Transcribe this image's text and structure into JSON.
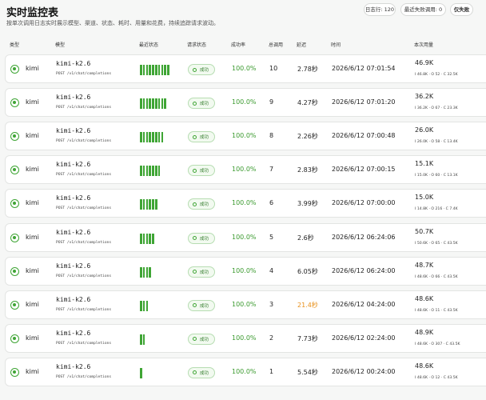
{
  "header": {
    "title": "实时监控表",
    "subtitle": "按单次调用日志实时展示模型、渠道、状态、耗时、用量和花费，持续追踪请求波动。",
    "stat_rows": "日志行: 120",
    "stat_failed": "最近失败调用: 0",
    "filter_button": "仅失败"
  },
  "table": {
    "columns": [
      "类型",
      "模型",
      "最近状态",
      "请求状态",
      "成功率",
      "总调用",
      "延迟",
      "时间",
      "本次用量"
    ],
    "rows": [
      {
        "provider": "kimi",
        "model": "kimi-k2.6",
        "endpoint": "POST /v1/chat/completions",
        "bars": 10,
        "status": "成功",
        "rate": "100.0%",
        "calls": "10",
        "latency": "2.78秒",
        "slow": false,
        "time": "2026/6/12 07:01:54",
        "usage": "46.9K",
        "usage_detail": "I 46.8K · O 52 · C 32.5K"
      },
      {
        "provider": "kimi",
        "model": "kimi-k2.6",
        "endpoint": "POST /v1/chat/completions",
        "bars": 9,
        "status": "成功",
        "rate": "100.0%",
        "calls": "9",
        "latency": "4.27秒",
        "slow": false,
        "time": "2026/6/12 07:01:20",
        "usage": "36.2K",
        "usage_detail": "I 36.2K · O 67 · C 23.3K"
      },
      {
        "provider": "kimi",
        "model": "kimi-k2.6",
        "endpoint": "POST /v1/chat/completions",
        "bars": 8,
        "status": "成功",
        "rate": "100.0%",
        "calls": "8",
        "latency": "2.26秒",
        "slow": false,
        "time": "2026/6/12 07:00:48",
        "usage": "26.0K",
        "usage_detail": "I 26.0K · O 58 · C 13.4K"
      },
      {
        "provider": "kimi",
        "model": "kimi-k2.6",
        "endpoint": "POST /v1/chat/completions",
        "bars": 7,
        "status": "成功",
        "rate": "100.0%",
        "calls": "7",
        "latency": "2.83秒",
        "slow": false,
        "time": "2026/6/12 07:00:15",
        "usage": "15.1K",
        "usage_detail": "I 15.0K · O 60 · C 13.1K"
      },
      {
        "provider": "kimi",
        "model": "kimi-k2.6",
        "endpoint": "POST /v1/chat/completions",
        "bars": 6,
        "status": "成功",
        "rate": "100.0%",
        "calls": "6",
        "latency": "3.99秒",
        "slow": false,
        "time": "2026/6/12 07:00:00",
        "usage": "15.0K",
        "usage_detail": "I 14.8K · O 216 · C 7.4K"
      },
      {
        "provider": "kimi",
        "model": "kimi-k2.6",
        "endpoint": "POST /v1/chat/completions",
        "bars": 5,
        "status": "成功",
        "rate": "100.0%",
        "calls": "5",
        "latency": "2.6秒",
        "slow": false,
        "time": "2026/6/12 06:24:06",
        "usage": "50.7K",
        "usage_detail": "I 50.6K · O 65 · C 43.5K"
      },
      {
        "provider": "kimi",
        "model": "kimi-k2.6",
        "endpoint": "POST /v1/chat/completions",
        "bars": 4,
        "status": "成功",
        "rate": "100.0%",
        "calls": "4",
        "latency": "6.05秒",
        "slow": false,
        "time": "2026/6/12 06:24:00",
        "usage": "48.7K",
        "usage_detail": "I 48.6K · O 66 · C 43.5K"
      },
      {
        "provider": "kimi",
        "model": "kimi-k2.6",
        "endpoint": "POST /v1/chat/completions",
        "bars": 3,
        "status": "成功",
        "rate": "100.0%",
        "calls": "3",
        "latency": "21.4秒",
        "slow": true,
        "time": "2026/6/12 04:24:00",
        "usage": "48.6K",
        "usage_detail": "I 48.6K · O 11 · C 43.5K"
      },
      {
        "provider": "kimi",
        "model": "kimi-k2.6",
        "endpoint": "POST /v1/chat/completions",
        "bars": 2,
        "status": "成功",
        "rate": "100.0%",
        "calls": "2",
        "latency": "7.73秒",
        "slow": false,
        "time": "2026/6/12 02:24:00",
        "usage": "48.9K",
        "usage_detail": "I 48.6K · O 307 · C 43.5K"
      },
      {
        "provider": "kimi",
        "model": "kimi-k2.6",
        "endpoint": "POST /v1/chat/completions",
        "bars": 1,
        "status": "成功",
        "rate": "100.0%",
        "calls": "1",
        "latency": "5.54秒",
        "slow": false,
        "time": "2026/6/12 00:24:00",
        "usage": "48.6K",
        "usage_detail": "I 48.6K · O 12 · C 43.5K"
      }
    ]
  },
  "colors": {
    "success": "#3fa535",
    "warning": "#e8901a"
  }
}
